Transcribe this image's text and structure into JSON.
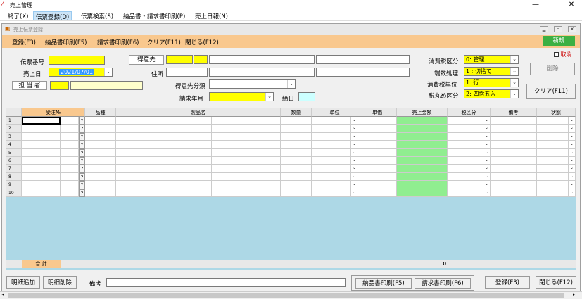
{
  "window": {
    "title": "売上管理",
    "controls": [
      "—",
      "❐",
      "✕"
    ]
  },
  "menu": [
    "終了(X)",
    "伝票登録(D)",
    "伝票検索(S)",
    "納品書・請求書印刷(P)",
    "売上日報(N)"
  ],
  "inner": {
    "title": "売上伝票登録",
    "menu": [
      "登録(F3)",
      "納品書印刷(F5)",
      "請求書印刷(F6)",
      "クリア(F11)",
      "閉じる(F12)"
    ],
    "new_label": "新規",
    "cancel_label": "取消",
    "delete_label": "削除",
    "clear_label": "クリア(F11)"
  },
  "form": {
    "slip_no_label": "伝票番号",
    "sales_date_label": "売上日",
    "sales_date": "2021/07/01",
    "staff_label": "担 当 者",
    "customer_label": "得意先",
    "address_label": "住所",
    "customer_class_label": "得意先分類",
    "billing_month_label": "請求年月",
    "closing_day_label": "締日",
    "tax_class_label": "消費税区分",
    "tax_class": "0: 管理",
    "rounding_label": "端数処理",
    "rounding": "1 : 切捨て",
    "tax_unit_label": "消費税単位",
    "tax_unit": "1: 行",
    "tax_round_label": "税丸め区分",
    "tax_round": "2: 四捨五入"
  },
  "table": {
    "headers": [
      "受注№",
      "品種",
      "製品名",
      "数量",
      "単位",
      "単価",
      "売上金額",
      "税区分",
      "備考",
      "状態"
    ],
    "rows": [
      "1",
      "2",
      "3",
      "4",
      "5",
      "6",
      "7",
      "8",
      "9",
      "10"
    ],
    "qmark": "?",
    "total_label": "合 計",
    "total_value": "0"
  },
  "bottom": {
    "add_row": "明細追加",
    "del_row": "明細削除",
    "memo_label": "備考",
    "print_delivery": "納品書印刷(F5)",
    "print_invoice": "請求書印刷(F6)",
    "register": "登録(F3)",
    "close": "閉じる(F12)"
  },
  "colors": {
    "accent_yellow": "#ffff00",
    "orange_bar": "#f9c88e",
    "green_new": "#3cb043",
    "grid_bg": "#add8e6",
    "sales_col": "#90ee90"
  }
}
